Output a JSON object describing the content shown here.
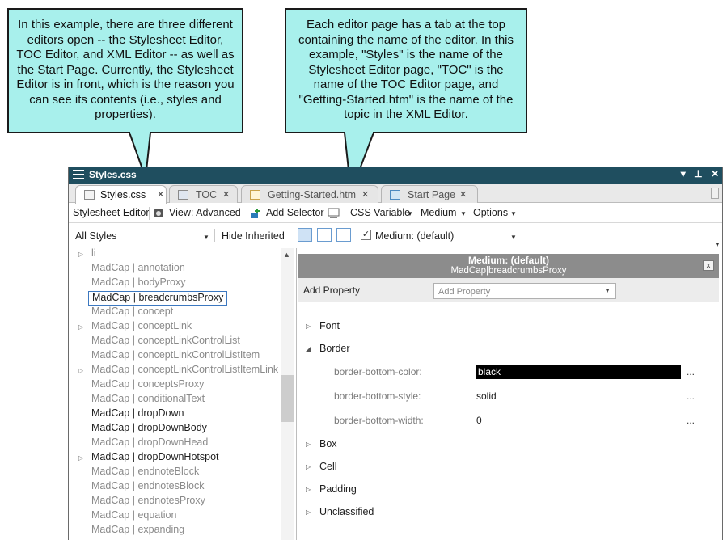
{
  "callouts": {
    "left": "In this example, there are three different editors open -- the Stylesheet Editor, TOC Editor, and XML Editor -- as well as the Start Page. Currently, the Stylesheet Editor is in front, which is the reason you can see its contents (i.e., styles and properties).",
    "right": "Each editor page has a tab at the top containing the name of the editor. In this example, \"Styles\" is the name of the Stylesheet Editor page, \"TOC\" is the name of the TOC Editor page, and \"Getting-Started.htm\" is the name of the topic in the XML Editor."
  },
  "window": {
    "title": "Styles.css",
    "controls": [
      "▾",
      "⊥",
      "✕"
    ]
  },
  "tabs": [
    {
      "label": "Styles.css",
      "icon": "stylesheet-icon",
      "active": true
    },
    {
      "label": "TOC",
      "icon": "toc-icon",
      "active": false
    },
    {
      "label": "Getting-Started.htm",
      "icon": "topic-file-icon",
      "active": false
    },
    {
      "label": "Start Page",
      "icon": "start-page-icon",
      "active": false
    }
  ],
  "tab_close": "✕",
  "toolbar": {
    "editor_label": "Stylesheet Editor",
    "view_label": "View: Advanced",
    "add_selector": "Add Selector",
    "css_variable": "CSS Variable",
    "medium": "Medium",
    "options": "Options"
  },
  "filterbar": {
    "styles_filter": "All Styles",
    "hide_inherited": "Hide Inherited",
    "medium_checked": true,
    "medium_value": "Medium: (default)"
  },
  "selectors": [
    {
      "label": "li",
      "expandable": true,
      "dim": true
    },
    {
      "label": "MadCap | annotation",
      "expandable": false,
      "dim": true
    },
    {
      "label": "MadCap | bodyProxy",
      "expandable": false,
      "dim": true
    },
    {
      "label": "MadCap | breadcrumbsProxy",
      "expandable": false,
      "dim": false,
      "selected": true
    },
    {
      "label": "MadCap | concept",
      "expandable": false,
      "dim": true
    },
    {
      "label": "MadCap | conceptLink",
      "expandable": true,
      "dim": true
    },
    {
      "label": "MadCap | conceptLinkControlList",
      "expandable": false,
      "dim": true
    },
    {
      "label": "MadCap | conceptLinkControlListItem",
      "expandable": false,
      "dim": true
    },
    {
      "label": "MadCap | conceptLinkControlListItemLink",
      "expandable": true,
      "dim": true
    },
    {
      "label": "MadCap | conceptsProxy",
      "expandable": false,
      "dim": true
    },
    {
      "label": "MadCap | conditionalText",
      "expandable": false,
      "dim": true
    },
    {
      "label": "MadCap | dropDown",
      "expandable": false,
      "dim": false
    },
    {
      "label": "MadCap | dropDownBody",
      "expandable": false,
      "dim": false
    },
    {
      "label": "MadCap | dropDownHead",
      "expandable": false,
      "dim": true
    },
    {
      "label": "MadCap | dropDownHotspot",
      "expandable": true,
      "dim": false
    },
    {
      "label": "MadCap | endnoteBlock",
      "expandable": false,
      "dim": true
    },
    {
      "label": "MadCap | endnotesBlock",
      "expandable": false,
      "dim": true
    },
    {
      "label": "MadCap | endnotesProxy",
      "expandable": false,
      "dim": true
    },
    {
      "label": "MadCap | equation",
      "expandable": false,
      "dim": true
    },
    {
      "label": "MadCap | expanding",
      "expandable": false,
      "dim": true
    }
  ],
  "properties": {
    "header_title": "Medium: (default)",
    "header_subtitle": "MadCap|breadcrumbsProxy",
    "add_property_label": "Add Property",
    "add_property_placeholder": "Add Property",
    "more_button": "...",
    "groups": [
      {
        "name": "Font",
        "expanded": false
      },
      {
        "name": "Border",
        "expanded": true,
        "props": [
          {
            "name": "border-bottom-color:",
            "value": "black",
            "swatch": "#000000"
          },
          {
            "name": "border-bottom-style:",
            "value": "solid"
          },
          {
            "name": "border-bottom-width:",
            "value": "0"
          }
        ]
      },
      {
        "name": "Box",
        "expanded": false
      },
      {
        "name": "Cell",
        "expanded": false
      },
      {
        "name": "Padding",
        "expanded": false
      },
      {
        "name": "Unclassified",
        "expanded": false
      }
    ]
  },
  "colors": {
    "titlebar": "#1f4e5f",
    "callout": "#a8f0ec",
    "header_gray": "#8c8c8c"
  }
}
